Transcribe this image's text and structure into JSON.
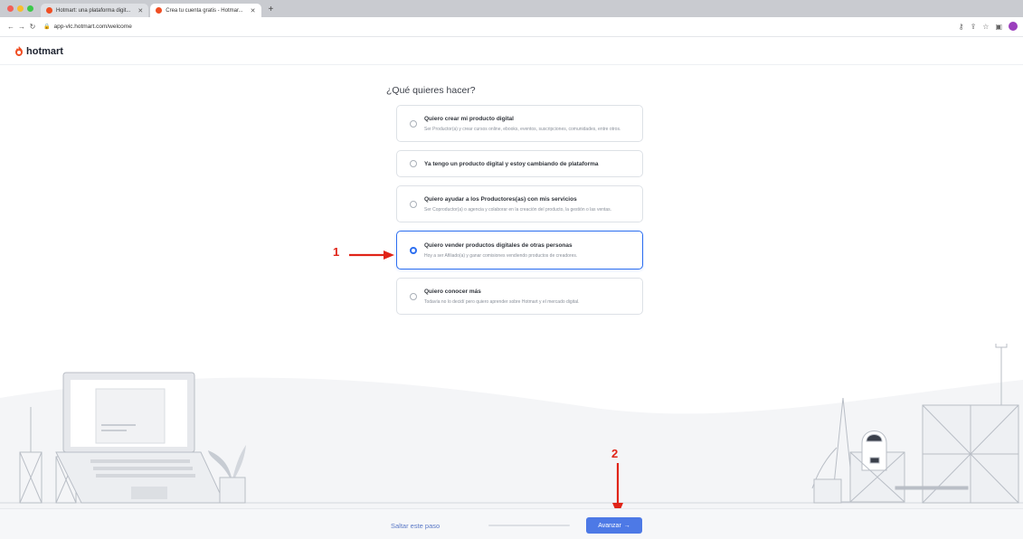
{
  "browser": {
    "tabs": [
      {
        "title": "Hotmart: una plataforma digit...",
        "active": false
      },
      {
        "title": "Crea tu cuenta gratis - Hotmar...",
        "active": true
      }
    ],
    "new_tab_symbol": "+",
    "url": "app-vlc.hotmart.com/welcome",
    "back_icon": "arrow-left-icon",
    "forward_icon": "arrow-right-icon",
    "reload_icon": "reload-icon"
  },
  "header": {
    "logo_text": "hotmart",
    "brand_color": "#f04e23"
  },
  "onboarding": {
    "question": "¿Qué quieres hacer?",
    "options": [
      {
        "title": "Quiero crear mi producto digital",
        "description": "Ser Productor(a) y crear cursos online, ebooks, eventos, suscripciones, comunidades, entre otros.",
        "selected": false
      },
      {
        "title": "Ya tengo un producto digital y estoy cambiando de plataforma",
        "description": "",
        "selected": false
      },
      {
        "title": "Quiero ayudar a los Productores(as) con mis servicios",
        "description": "Ser Coproductor(a) o agencia y colaborar en la creación del producto, la gestión o las ventas.",
        "selected": false
      },
      {
        "title": "Quiero vender productos digitales de otras personas",
        "description": "Hoy a ser Afiliado(a) y ganar comisiones vendiendo productos de creadores.",
        "selected": true
      },
      {
        "title": "Quiero conocer más",
        "description": "Todavía no lo decidí pero quiero aprender sobre Hotmart y el mercado digital.",
        "selected": false
      }
    ],
    "accent_color": "#2d6ff0"
  },
  "annotations": {
    "step1": "1",
    "step2": "2",
    "color": "#e02418"
  },
  "footer": {
    "skip_label": "Saltar este paso",
    "advance_label": "Avanzar",
    "advance_icon": "arrow-right-icon",
    "progress_fraction": 0.0
  }
}
